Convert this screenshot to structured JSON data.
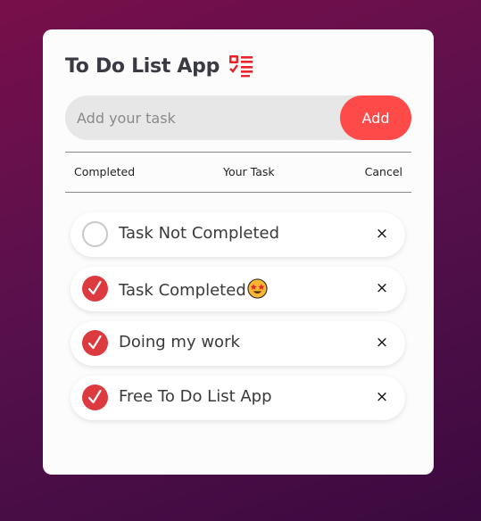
{
  "app": {
    "title": "To Do List App",
    "title_icon": "checklist-icon"
  },
  "input": {
    "placeholder": "Add your task",
    "value": "",
    "add_label": "Add"
  },
  "header": {
    "completed": "Completed",
    "task": "Your Task",
    "cancel": "Cancel"
  },
  "tasks": [
    {
      "label": "Task Not Completed",
      "completed": false,
      "remove": "×"
    },
    {
      "label": "Task Completed",
      "emoji": "star-struck-emoji",
      "completed": true,
      "remove": "×"
    },
    {
      "label": "Doing my work",
      "completed": true,
      "remove": "×"
    },
    {
      "label": "Free To Do List App",
      "completed": true,
      "remove": "×"
    }
  ],
  "colors": {
    "accent": "#ff4a4a",
    "check_on": "#dd3a3f",
    "bg_top": "#780f4a",
    "bg_bottom": "#3b0a3f"
  }
}
